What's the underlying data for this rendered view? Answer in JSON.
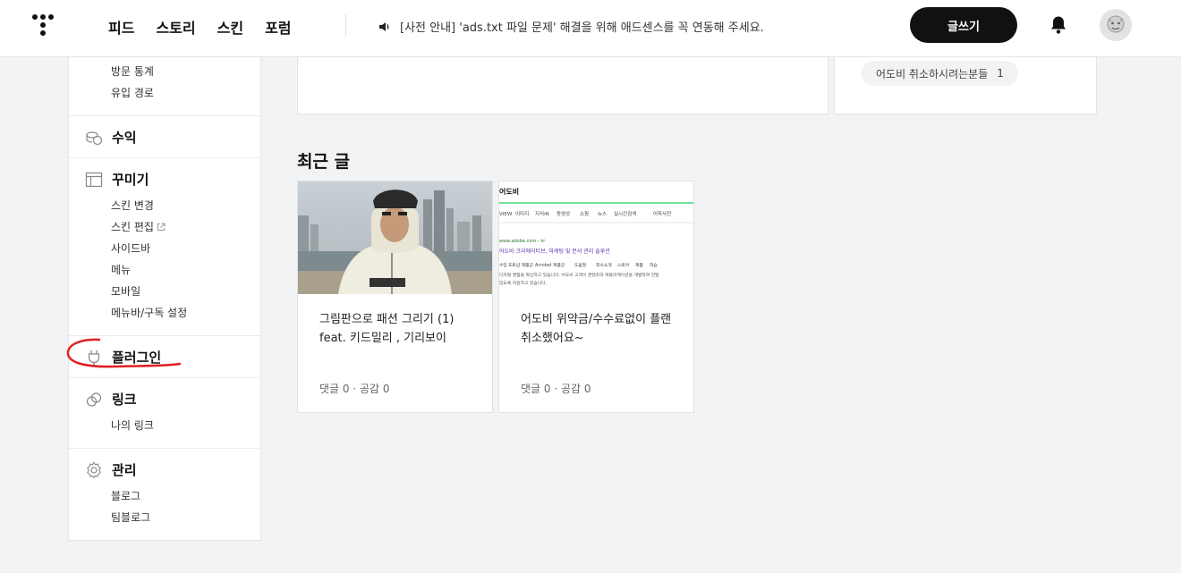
{
  "header": {
    "nav": [
      "피드",
      "스토리",
      "스킨",
      "포럼"
    ],
    "notice": "[사전 안내] 'ads.txt 파일 문제' 해결을 위해 애드센스를 꼭 연동해 주세요.",
    "write_label": "글쓰기"
  },
  "sidebar": {
    "stats_items": [
      "방문 통계",
      "유입 경로"
    ],
    "revenue": "수익",
    "decor": {
      "title": "꾸미기",
      "items": [
        "스킨 변경",
        "스킨 편집",
        "사이드바",
        "메뉴",
        "모바일",
        "메뉴바/구독 설정"
      ]
    },
    "plugin": "플러그인",
    "link": {
      "title": "링크",
      "items": [
        "나의 링크"
      ]
    },
    "manage": {
      "title": "관리",
      "items": [
        "블로그",
        "팀블로그"
      ]
    }
  },
  "tag_chip": {
    "label": "어도비 취소하시려는분들",
    "count": "1"
  },
  "recent": {
    "title": "최근 글",
    "posts": [
      {
        "title": "그림판으로 패션 그리기 (1) feat. 키드밀리 , 기리보이",
        "comments": "댓글 0",
        "likes": "공감 0"
      },
      {
        "title": "어도비 위약금/수수료없이 플랜취소했어요~",
        "comments": "댓글 0",
        "likes": "공감 0"
      }
    ],
    "thumb2": {
      "brand": "어도비",
      "tabs": [
        "VIEW",
        "이미지",
        "지식iN",
        "동영상",
        "쇼핑",
        "뉴스",
        "실시간검색",
        "어학사전"
      ],
      "url": "www.adobe.com › kr",
      "result_title": "어도비 크리에이티브, 마케팅 및 문서 관리 솔루션",
      "links": [
        "수입",
        "포토샵 제품군",
        "Acrobat 제품군",
        "도움말",
        "회사소개",
        "스토어",
        "제품",
        "학습"
      ],
      "desc1": "디지털 경험을 혁신하고 있습니다. 어도비 고객이 콘텐츠와 애플리케이션을 개발하여 전달",
      "desc2": "있도록 지원하고 있습니다."
    }
  },
  "colors": {
    "accent_red": "#e02020",
    "button_bg": "#111111"
  }
}
